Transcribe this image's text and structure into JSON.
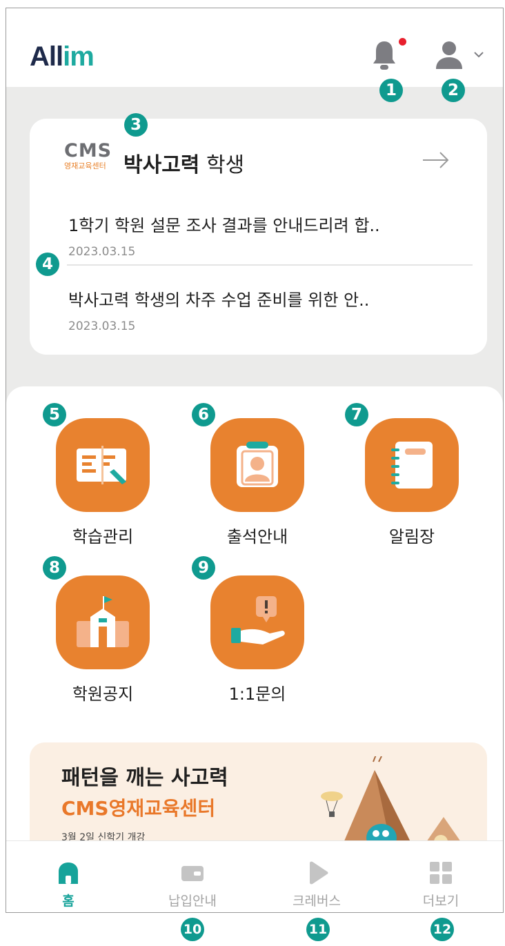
{
  "app": {
    "logo_text": "All",
    "logo_text_accent": "im"
  },
  "colors": {
    "accent_teal": "#16a39a",
    "tile_orange": "#e8822f",
    "badge_teal": "#0f9a8f",
    "notification_dot": "#e8202d"
  },
  "header": {
    "bell_icon": "bell-icon",
    "profile_icon": "user-icon",
    "dropdown_icon": "chevron-down-icon"
  },
  "student_card": {
    "brand_letters": "CMS",
    "brand_sub": "영재교육센터",
    "student_name": "박사고력",
    "student_suffix": "학생",
    "notices": [
      {
        "title": "1학기 학원 설문 조사 결과를 안내드리려 합..",
        "date": "2023.03.15"
      },
      {
        "title": "박사고력 학생의 차주 수업 준비를 위한 안..",
        "date": "2023.03.15"
      }
    ]
  },
  "menu": [
    {
      "label": "학습관리",
      "icon": "study-management-icon"
    },
    {
      "label": "출석안내",
      "icon": "attendance-icon"
    },
    {
      "label": "알림장",
      "icon": "notebook-icon"
    },
    {
      "label": "학원공지",
      "icon": "academy-notice-icon"
    },
    {
      "label": "1:1문의",
      "icon": "inquiry-icon"
    }
  ],
  "banner": {
    "title": "패턴을 깨는 사고력",
    "subtitle": "CMS영재교육센터",
    "small_text": "3월 2일 신학기 개강"
  },
  "tabs": [
    {
      "label": "홈",
      "icon": "home-icon",
      "active": true
    },
    {
      "label": "납입안내",
      "icon": "wallet-icon",
      "active": false
    },
    {
      "label": "크레버스",
      "icon": "play-icon",
      "active": false
    },
    {
      "label": "더보기",
      "icon": "grid-icon",
      "active": false
    }
  ],
  "badges": [
    "1",
    "2",
    "3",
    "4",
    "5",
    "6",
    "7",
    "8",
    "9",
    "10",
    "11",
    "12"
  ]
}
